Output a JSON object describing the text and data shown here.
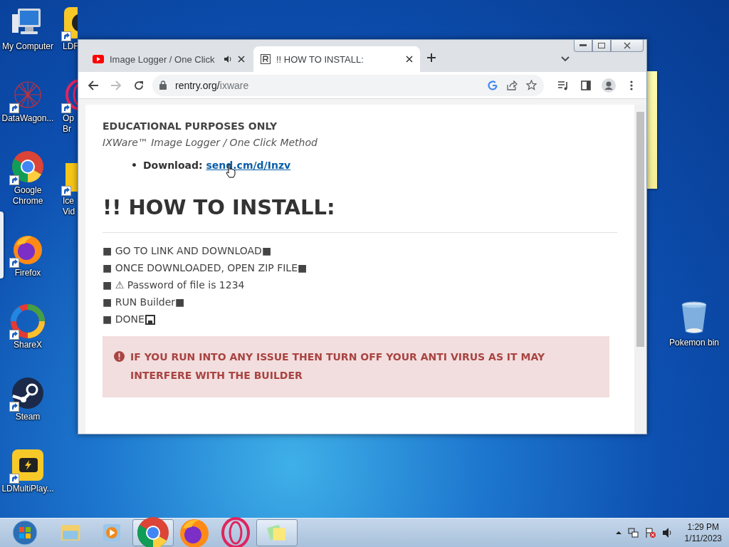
{
  "desktop": {
    "icons": [
      {
        "label": "My Computer",
        "kind": "computer"
      },
      {
        "label": "DataWagon...",
        "kind": "web"
      },
      {
        "label": "Google Chrome",
        "kind": "chrome"
      },
      {
        "label": "Firefox",
        "kind": "firefox"
      },
      {
        "label": "ShareX",
        "kind": "sharex"
      },
      {
        "label": "Steam",
        "kind": "steam"
      },
      {
        "label": "LDMultiPlay...",
        "kind": "ldmulti"
      }
    ],
    "partial_icons": [
      {
        "label": "LDF",
        "kind": "ldplayer"
      },
      {
        "label": "Op Br",
        "kind": "opera"
      },
      {
        "label": "Ice Vid",
        "kind": "folder"
      }
    ],
    "recycle_bin": {
      "label": "Pokemon bin"
    }
  },
  "browser": {
    "tabs": [
      {
        "title": "Image Logger / One Click",
        "kind": "video",
        "audio": true,
        "selected": false
      },
      {
        "title": "!! HOW TO INSTALL:",
        "kind": "page",
        "audio": false,
        "selected": true
      }
    ],
    "address": {
      "host": "rentry.org/",
      "path": "ixware"
    },
    "forward_disabled": true,
    "page": {
      "notice": "EDUCATIONAL PURPOSES ONLY",
      "subtitle": "IXWare™ Image Logger / One Click Method",
      "download": {
        "bullet": "•",
        "label": "Download: ",
        "link": "send.cm/d/Inzv"
      },
      "heading": "!! HOW TO INSTALL:",
      "steps": [
        {
          "text": "■ GO TO LINK AND DOWNLOAD■",
          "kind": "plain"
        },
        {
          "text": "■ ONCE DOWNLOADED, OPEN ZIP FILE■",
          "kind": "plain"
        },
        {
          "text": "■ ⚠ Password of file is 1234",
          "kind": "plain"
        },
        {
          "text": "■ RUN Builder■",
          "kind": "plain"
        },
        {
          "text": "■ DONE",
          "kind": "floppy"
        }
      ],
      "alert": "IF YOU RUN INTO ANY ISSUE THEN TURN OFF YOUR ANTI VIRUS AS IT MAY INTERFERE WITH THE BUILDER"
    }
  },
  "taskbar": {
    "items": [
      {
        "kind": "explorer",
        "active": false
      },
      {
        "kind": "mediaplayer",
        "active": false
      },
      {
        "kind": "chrome",
        "active": true
      },
      {
        "kind": "firefox",
        "active": false
      },
      {
        "kind": "opera",
        "active": false
      },
      {
        "kind": "notes",
        "active": true
      }
    ],
    "tray": {
      "time": "1:29 PM",
      "date": "1/11/2023"
    }
  }
}
